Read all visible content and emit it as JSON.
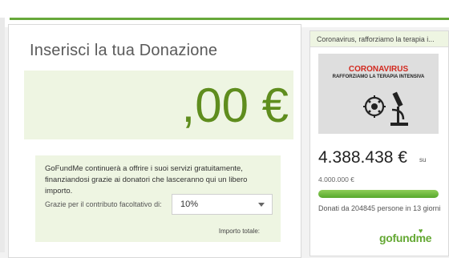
{
  "donation": {
    "title": "Inserisci la tua Donazione",
    "amount_value": ",00 €",
    "info_text": "GoFundMe continuerà a offrire i suoi servizi gratuitamente, finanziandosi grazie ai donatori che lasceranno qui un libero importo.",
    "tip_label": "Grazie per il contributo facoltativo di:",
    "tip_selected": "10%",
    "total_label": "Importo totale:"
  },
  "campaign": {
    "header_title": "Coronavirus, rafforziamo la terapia i...",
    "image_title": "CORONAVIRUS",
    "image_subtitle": "RAFFORZIAMO LA TERAPIA INTENSIVA",
    "raised": "4.388.438 €",
    "raised_suffix": "su",
    "goal": "4.000.000 €",
    "progress_percent": 100,
    "donors_text": "Donati da 204845 persone in 13 giorni",
    "logo_text": "gofundme"
  },
  "colors": {
    "brand_green": "#64a833",
    "amount_green": "#5f8d1e",
    "panel_tint": "#eef5e2",
    "image_red": "#d2281e"
  },
  "icons": {
    "select_caret": "chevron-down-icon",
    "image_graphic": "microscope-virus-icon"
  }
}
